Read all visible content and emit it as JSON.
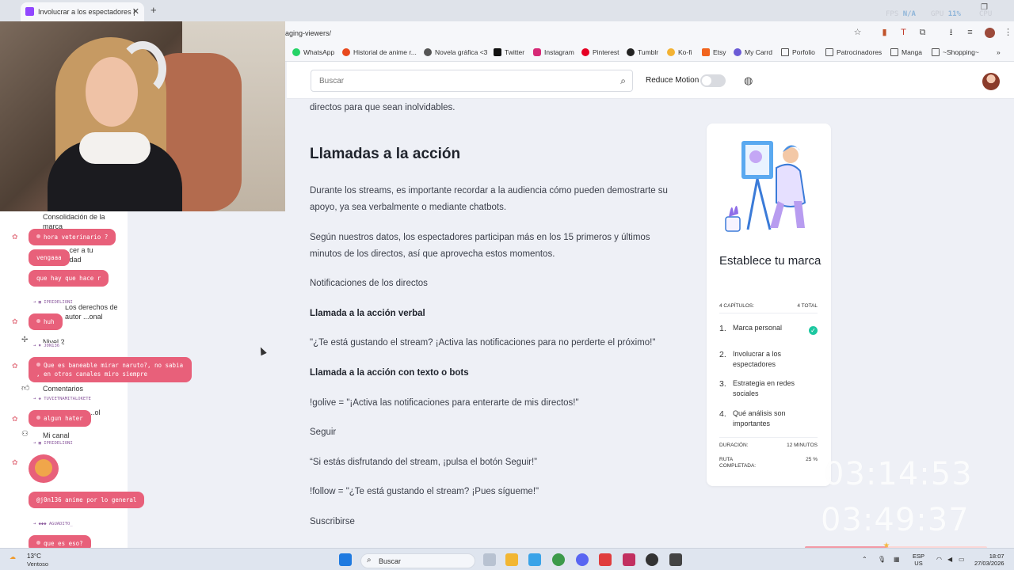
{
  "browser": {
    "tab_title": "Involucrar a los espectadores |",
    "url_fragment": "aging-viewers/",
    "overlay_stats": {
      "fps_label": "FPS",
      "fps_value": "N/A",
      "gpu_label": "GPU",
      "gpu_value": "11%",
      "cpu_label": "CPU"
    },
    "bookmarks": [
      "WhatsApp",
      "Historial de anime r...",
      "Novela gráfica <3",
      "Twitter",
      "Instagram",
      "Pinterest",
      "Tumblr",
      "Ko-fi",
      "Etsy",
      "My Carrd",
      "Porfolio",
      "Patrocinadores",
      "Manga",
      "~Shopping~"
    ]
  },
  "header": {
    "search_placeholder": "Buscar",
    "reduce_motion_label": "Reduce Motion",
    "reduce_motion_on": false
  },
  "article": {
    "intro_tail": "directos para que sean inolvidables.",
    "heading": "Llamadas a la acción",
    "p1": "Durante los streams, es importante recordar a la audiencia cómo pueden demostrarte su apoyo, ya sea verbalmente o mediante chatbots.",
    "p2": "Según nuestros datos, los espectadores participan más en los 15 primeros y últimos minutos de los directos, así que aprovecha estos momentos.",
    "p3": "Notificaciones de los directos",
    "h_verbal": "Llamada a la acción verbal",
    "quote_verbal": "\"¿Te está gustando el stream? ¡Activa las notificaciones para no perderte el próximo!\"",
    "h_bots": "Llamada a la acción con texto o bots",
    "golive": "!golive = \"¡Activa las notificaciones para enterarte de mis directos!\"",
    "seguir": "Seguir",
    "quote_seguir": "“Si estás disfrutando del stream, ¡pulsa el botón Seguir!”",
    "follow": "!follow = \"¿Te está gustando el stream? ¡Pues sígueme!\"",
    "suscribirse": "Suscribirse"
  },
  "course_card": {
    "title": "Establece tu marca",
    "chapters_label": "4 CAPÍTULOS:",
    "total_label": "4 TOTAL",
    "chapters": [
      {
        "num": "1.",
        "title": "Marca personal",
        "done": true
      },
      {
        "num": "2.",
        "title": "Involucrar a los espectadores",
        "done": false
      },
      {
        "num": "3.",
        "title": "Estrategia en redes sociales",
        "done": false
      },
      {
        "num": "4.",
        "title": "Qué análisis son importantes",
        "done": false
      }
    ],
    "duration_label": "DURACIÓN:",
    "duration_value": "12 MINUTOS",
    "route_label": "RUTA COMPLETADA:",
    "route_value": "25 %",
    "route_fraction": 0.25
  },
  "overlay": {
    "timer_top": "03:14:53",
    "timer_bottom": "03:49:37",
    "progress_fraction": 0.45
  },
  "sidebar": {
    "items": [
      {
        "label": "Consolidación de la marca"
      },
      {
        "label": "...cer a tu ...dad"
      },
      {
        "label": "Los derechos de autor ...onal"
      },
      {
        "label": "Nivel 2"
      },
      {
        "label": "Comentarios"
      },
      {
        "label": "...ol"
      },
      {
        "label": "Mi canal"
      }
    ]
  },
  "chat": {
    "messages": [
      {
        "user": "",
        "text": "hora veterinario ?"
      },
      {
        "user": "",
        "text": "vengaaa"
      },
      {
        "user": "",
        "text": "que hay que hace r"
      },
      {
        "user": "IPRIDELIONI",
        "text": "huh"
      },
      {
        "user": "J0N136",
        "text": "Que es baneable mirar naruto?, no sabia , en otros canales miro siempre"
      },
      {
        "user": "TUVIETNAMITALOKETE",
        "text": "algun hater"
      },
      {
        "user": "IPRIDELIONI",
        "text": ""
      },
      {
        "user": "",
        "text": "@j0n136 anime por lo general"
      },
      {
        "user": "AGUADITO_",
        "text": "que es eso?"
      }
    ]
  },
  "taskbar": {
    "weather_temp": "13°C",
    "weather_desc": "Ventoso",
    "search_placeholder": "Buscar",
    "lang_top": "ESP",
    "lang_bottom": "US",
    "time": "18:07",
    "date": "27/03/2026"
  }
}
